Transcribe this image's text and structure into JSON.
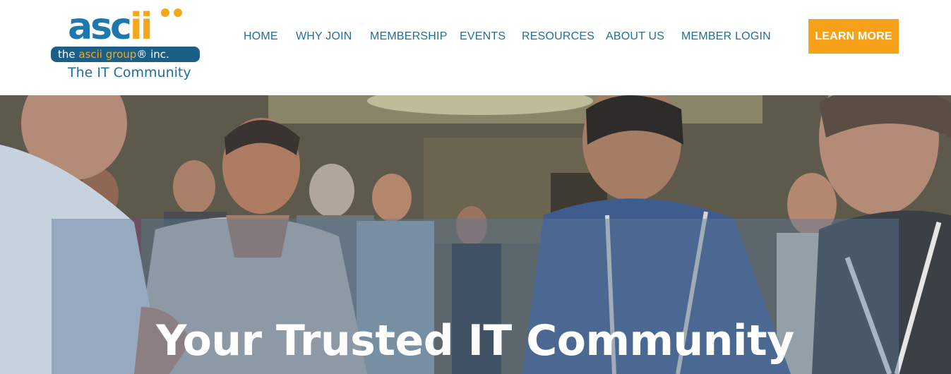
{
  "header": {
    "logo": {
      "wordmark_main": "asc",
      "wordmark_accent": "ii",
      "band_prefix": "the ",
      "band_name": "ascii group",
      "band_suffix": "® inc.",
      "tagline": "The IT Community",
      "colors": {
        "blue": "#1e78ad",
        "orange": "#f5a71c",
        "band": "#1b5e86"
      }
    },
    "nav": {
      "items": [
        {
          "label": "HOME"
        },
        {
          "label": "WHY JOIN"
        },
        {
          "label": "MEMBERSHIP"
        },
        {
          "label": "EVENTS"
        },
        {
          "label": "RESOURCES"
        },
        {
          "label": "ABOUT US"
        },
        {
          "label": "MEMBER LOGIN"
        }
      ],
      "color": "#1f6f9f"
    },
    "cta": {
      "label": "LEARN MORE",
      "color": "#f7a11a"
    }
  },
  "hero": {
    "headline": "Your Trusted IT Community",
    "image_subject": "event-crowd-photo"
  }
}
